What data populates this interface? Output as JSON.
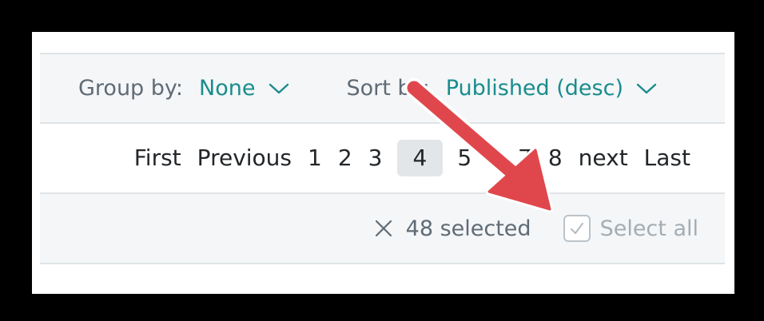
{
  "toolbar": {
    "group_by_label": "Group by:",
    "group_by_value": "None",
    "sort_by_label": "Sort by:",
    "sort_by_value": "Published (desc)"
  },
  "pagination": {
    "first": "First",
    "previous": "Previous",
    "pages": [
      "1",
      "2",
      "3",
      "4",
      "5",
      "6",
      "7",
      "8"
    ],
    "current_page": "4",
    "next": "next",
    "last": "Last"
  },
  "selection": {
    "clear_icon": "close-icon",
    "count_text": "48 selected",
    "select_all_label": "Select all"
  },
  "annotation": {
    "arrow_color": "#e0474c",
    "arrow_target": "select-all-checkbox"
  },
  "colors": {
    "accent": "#1a8c8c",
    "toolbar_bg": "#f4f6f8",
    "current_page_bg": "#e3e6e9"
  }
}
